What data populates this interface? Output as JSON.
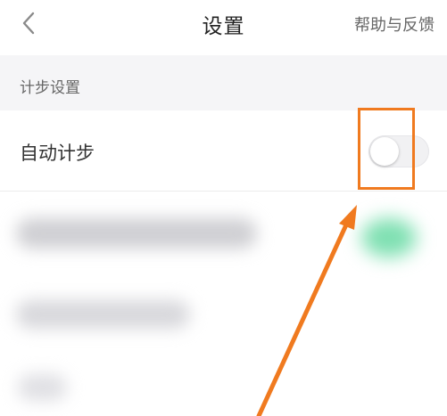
{
  "header": {
    "title": "设置",
    "help_label": "帮助与反馈",
    "back_icon": "chevron-left-icon"
  },
  "section": {
    "title": "计步设置"
  },
  "auto_step": {
    "label": "自动计步",
    "enabled": false
  },
  "annotation": {
    "highlight_color": "#f07a1f",
    "arrow_color": "#f07a1f"
  },
  "colors": {
    "section_bg": "#f5f5f7",
    "text_primary": "#222222",
    "text_secondary": "#666666",
    "blurred_toggle_accent": "#7fe0b2"
  }
}
